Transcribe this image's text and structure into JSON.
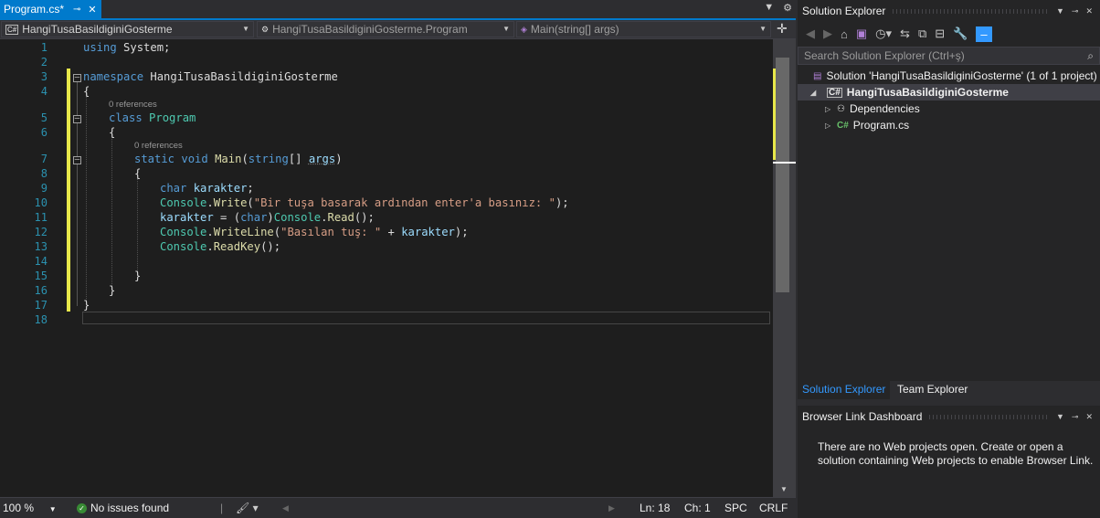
{
  "tab": {
    "title": "Program.cs*",
    "pin": "⊸",
    "close": "✕"
  },
  "navbar": {
    "project": "HangiTusaBasildiginiGosterme",
    "project_badge": "C#",
    "class": "HangiTusaBasildiginiGosterme.Program",
    "member": "Main(string[] args)"
  },
  "code": {
    "line_numbers": [
      "1",
      "2",
      "3",
      "4",
      "5",
      "6",
      "7",
      "8",
      "9",
      "10",
      "11",
      "12",
      "13",
      "14",
      "15",
      "16",
      "17",
      "18"
    ],
    "lines": {
      "l1_kw": "using",
      "l1_rest": " System;",
      "l3_kw": "namespace",
      "l3_rest": " HangiTusaBasildiginiGosterme",
      "l4": "{",
      "lens1": "0 references",
      "l5_kw": "class",
      "l5_ty": "Program",
      "l6": "{",
      "lens2": "0 references",
      "l7_kw1": "static",
      "l7_kw2": "void",
      "l7_fn": "Main",
      "l7_open": "(",
      "l7_kw3": "string",
      "l7_br": "[] ",
      "l7_prm": "args",
      "l7_close": ")",
      "l8": "{",
      "l9_kw": "char",
      "l9_var": "karakter",
      "l9_end": ";",
      "l10_ty": "Console",
      "l10_dot": ".",
      "l10_fn": "Write",
      "l10_open": "(",
      "l10_str": "\"Bir tuşa basarak ardından enter'a basınız: \"",
      "l10_end": ");",
      "l11_var": "karakter",
      "l11_eq": " = (",
      "l11_kw": "char",
      "l11_close": ")",
      "l11_ty": "Console",
      "l11_dot": ".",
      "l11_fn": "Read",
      "l11_end": "();",
      "l12_ty": "Console",
      "l12_dot": ".",
      "l12_fn": "WriteLine",
      "l12_open": "(",
      "l12_str": "\"Basılan tuş: \"",
      "l12_plus": " + ",
      "l12_var": "karakter",
      "l12_end": ");",
      "l13_ty": "Console",
      "l13_dot": ".",
      "l13_fn": "ReadKey",
      "l13_end": "();",
      "l15": "}",
      "l16": "}",
      "l17": "}"
    }
  },
  "statusbar": {
    "zoom": "100 %",
    "issues": "No issues found",
    "line": "Ln: 18",
    "col": "Ch: 1",
    "spc": "SPC",
    "crlf": "CRLF"
  },
  "solution_explorer": {
    "title": "Solution Explorer",
    "search_placeholder": "Search Solution Explorer (Ctrl+ş)",
    "solution": "Solution 'HangiTusaBasildiginiGosterme' (1 of 1 project)",
    "project": "HangiTusaBasildiginiGosterme",
    "items": [
      "Dependencies",
      "Program.cs"
    ]
  },
  "panel_tabs": [
    "Solution Explorer",
    "Team Explorer"
  ],
  "browser_link": {
    "title": "Browser Link Dashboard",
    "message": "There are no Web projects open. Create or open a solution containing Web projects to enable Browser Link."
  }
}
